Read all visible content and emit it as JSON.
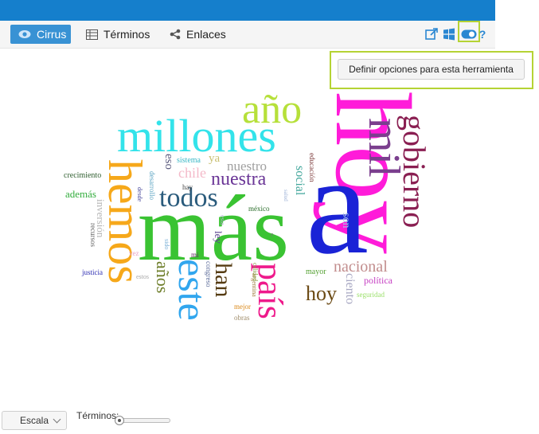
{
  "toolbar": {
    "tabs": [
      {
        "label": "Cirrus",
        "icon": "eye-icon"
      },
      {
        "label": "Términos",
        "icon": "table-icon"
      },
      {
        "label": "Enlaces",
        "icon": "share-icon"
      }
    ],
    "help_label": "?"
  },
  "tooltip": {
    "label": "Definir opciones para esta herramienta"
  },
  "colors": {
    "brand_bar": "#157fcc",
    "active_tab": "#3892d4",
    "highlight": "#b5d334"
  },
  "cloud": {
    "words": [
      {
        "text": "año",
        "color": "#b6e03a"
      },
      {
        "text": "millones",
        "color": "#33e3ea"
      },
      {
        "text": "hoy",
        "color": "#7b4713"
      },
      {
        "text": "mil",
        "color": "#7b3f8e"
      },
      {
        "text": "gobierno",
        "color": "#8a1f52"
      },
      {
        "text": "más",
        "color": "#3ac332"
      },
      {
        "text": "todos",
        "color": "#2a5b7c"
      },
      {
        "text": "nuestra",
        "color": "#6a3596"
      },
      {
        "text": "nuestro",
        "color": "#a0a0a0"
      },
      {
        "text": "chile",
        "color": "#f4b9c9"
      },
      {
        "text": "ya",
        "color": "#c9c072"
      },
      {
        "text": "eso",
        "color": "#5b5b7e"
      },
      {
        "text": "sistema",
        "color": "#39b8c6"
      },
      {
        "text": "crecimiento",
        "color": "#2f5e2f"
      },
      {
        "text": "además",
        "color": "#33ad3d"
      },
      {
        "text": "hay",
        "color": "#4a4a4a"
      },
      {
        "text": "social",
        "color": "#43a79c"
      },
      {
        "text": "educación",
        "color": "#7a3636"
      },
      {
        "text": "salud",
        "color": "#9fb4d8"
      },
      {
        "text": "son",
        "color": "#a9c5ea"
      },
      {
        "text": "méxico",
        "color": "#2b6e2b"
      },
      {
        "text": "nacional",
        "color": "#c28d8d"
      },
      {
        "text": "política",
        "color": "#c640c3"
      },
      {
        "text": "mayor",
        "color": "#53a030"
      },
      {
        "text": "seguridad",
        "color": "#9be06a"
      },
      {
        "text": "hoy",
        "color": "#6b4a14"
      },
      {
        "text": "ciento",
        "color": "#a7a7c2"
      },
      {
        "text": "justicia",
        "color": "#2a2ab1"
      },
      {
        "text": "estos",
        "color": "#a8a8a8"
      },
      {
        "text": "vez",
        "color": "#e8a3c7"
      },
      {
        "text": "mi",
        "color": "#6a2d6a"
      },
      {
        "text": "mejor",
        "color": "#db8a1b"
      },
      {
        "text": "obras",
        "color": "#a08d6b"
      },
      {
        "text": "e",
        "color": "#7a7a7a"
      }
    ],
    "vertical_words": [
      {
        "text": "hemos",
        "color": "#f6a81a"
      },
      {
        "text": "este",
        "color": "#31a6ee"
      },
      {
        "text": "años",
        "color": "#6e7e2a"
      },
      {
        "text": "han",
        "color": "#553b12"
      },
      {
        "text": "país",
        "color": "#ee1a8b"
      },
      {
        "text": "ley",
        "color": "#5b4390"
      },
      {
        "text": "congreso",
        "color": "#5b6b99"
      },
      {
        "text": "argentina",
        "color": "#a07f40"
      },
      {
        "text": "calidad",
        "color": "#8fa34e"
      },
      {
        "text": "desde",
        "color": "#4c4c9e"
      },
      {
        "text": "desarrollo",
        "color": "#5aa3c2"
      },
      {
        "text": "inversión",
        "color": "#b5b5b5"
      },
      {
        "text": "recursos",
        "color": "#5b5b5b"
      },
      {
        "text": "sido",
        "color": "#7fb3d8"
      },
      {
        "text": "esta",
        "color": "#b4b4d2"
      }
    ],
    "big_word": {
      "text": "hoy",
      "color": "#ff1bd9"
    },
    "big_word2": {
      "text": "a",
      "color": "#1a23d6"
    }
  },
  "bottom": {
    "scale_label": "Escala",
    "terms_label": "Términos:"
  }
}
